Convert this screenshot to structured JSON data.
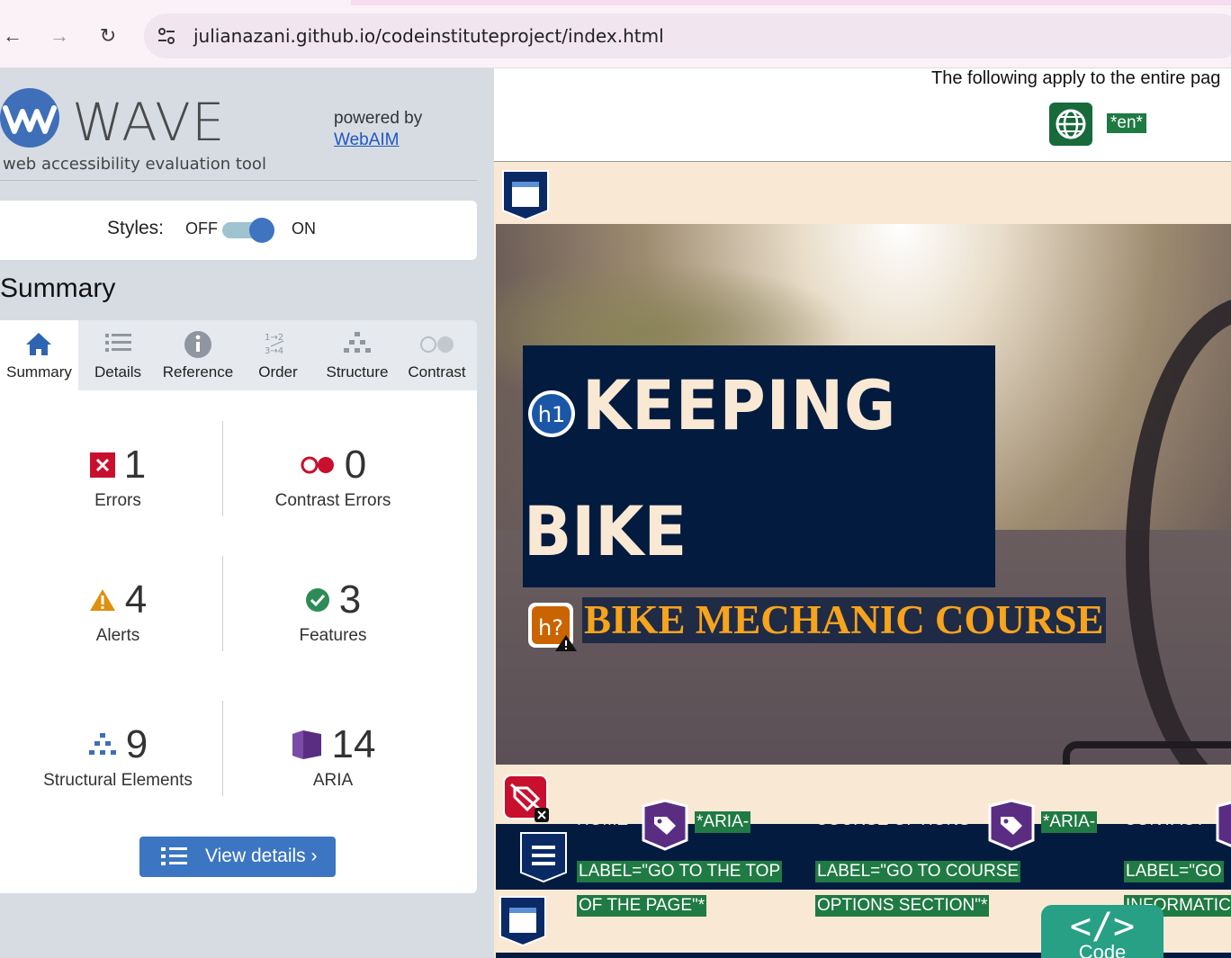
{
  "browser": {
    "url": "julianazani.github.io/codeinstituteproject/index.html"
  },
  "wave": {
    "title": "WAVE",
    "subtitle": "web accessibility evaluation tool",
    "powered_by": "powered by",
    "webaim": "WebAIM",
    "styles_label": "Styles:",
    "styles_off": "OFF",
    "styles_on": "ON",
    "styles_enabled": true,
    "summary_heading": "Summary",
    "tabs": [
      {
        "label": "Summary",
        "icon": "home-icon",
        "active": true
      },
      {
        "label": "Details",
        "icon": "list-icon",
        "active": false
      },
      {
        "label": "Reference",
        "icon": "info-icon",
        "active": false
      },
      {
        "label": "Order",
        "icon": "order-icon",
        "active": false
      },
      {
        "label": "Structure",
        "icon": "structure-icon",
        "active": false
      },
      {
        "label": "Contrast",
        "icon": "contrast-icon",
        "active": false
      }
    ],
    "stats": {
      "errors": {
        "count": "1",
        "label": "Errors"
      },
      "contrast_errors": {
        "count": "0",
        "label": "Contrast Errors"
      },
      "alerts": {
        "count": "4",
        "label": "Alerts"
      },
      "features": {
        "count": "3",
        "label": "Features"
      },
      "structural": {
        "count": "9",
        "label": "Structural Elements"
      },
      "aria": {
        "count": "14",
        "label": "ARIA"
      }
    },
    "view_details": "View details ›",
    "colors": {
      "brand_blue": "#3c76c3",
      "error_red": "#c8102e",
      "alert_orange": "#e0900f",
      "feature_green": "#2e8b57",
      "aria_purple": "#5a2d82"
    }
  },
  "page": {
    "top_note": "The following apply to the entire pag",
    "lang_label": "*en*",
    "h1_line1": "KEEPING",
    "h1_line2": "BIKE",
    "h1_badge": "h1",
    "h2_badge": "h?",
    "h2_text": "BIKE MECHANIC COURSE",
    "nav": [
      {
        "text": "HOME",
        "aria_a": "*ARIA-",
        "aria_b": "LABEL=\"GO TO THE TOP",
        "aria_c": "OF THE PAGE\"*"
      },
      {
        "text": "COURSE OPTIONS",
        "aria_a": "*ARIA-",
        "aria_b": "LABEL=\"GO TO COURSE",
        "aria_c": "OPTIONS SECTION\"*"
      },
      {
        "text": "CONTACT",
        "aria_a": "",
        "aria_b": "LABEL=\"GO",
        "aria_c": "INFORMATIC"
      }
    ],
    "code_symbol": "</>",
    "code_label": "Code"
  }
}
